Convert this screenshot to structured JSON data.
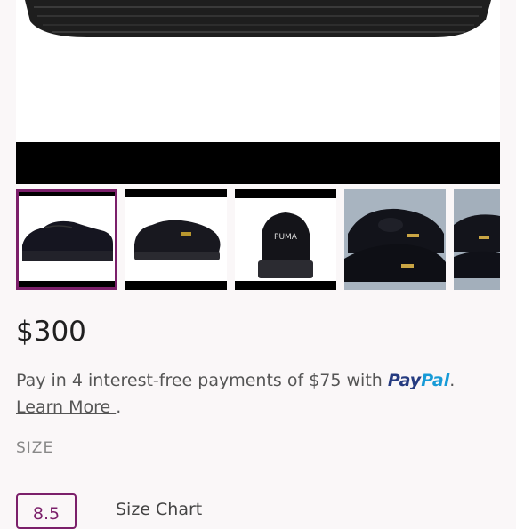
{
  "listing": {
    "price": "$300",
    "paypal_text": "Pay in 4 interest-free payments of $75 with",
    "paypal_brand_pay": "Pay",
    "paypal_brand_pal": "Pal",
    "paypal_period": ".",
    "learn_more": "Learn More ",
    "learn_more_period": ".",
    "size_heading": "SIZE",
    "selected_size": "8.5",
    "size_chart": "Size Chart"
  },
  "colors": {
    "accent": "#7b1f6a",
    "paypal_dark": "#253b80",
    "paypal_light": "#179bd7"
  },
  "thumbnails": [
    {
      "icon": "black-suede-creeper-side-icon",
      "selected": true
    },
    {
      "icon": "black-suede-creeper-angle-icon",
      "selected": false
    },
    {
      "icon": "black-suede-creeper-back-icon",
      "selected": false
    },
    {
      "icon": "velvet-creeper-pair-icon",
      "selected": false
    },
    {
      "icon": "velvet-creeper-partial-icon",
      "selected": false
    }
  ]
}
